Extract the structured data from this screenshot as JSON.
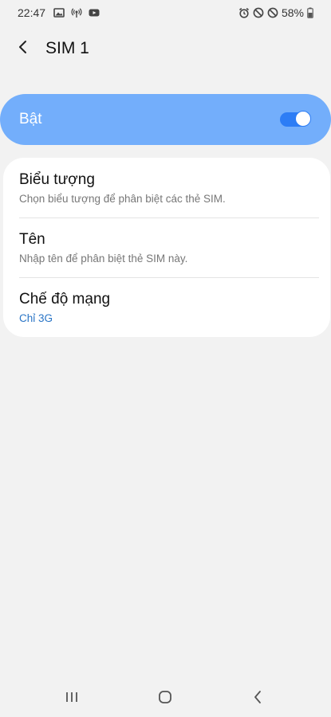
{
  "status_bar": {
    "time": "22:47",
    "battery_percent": "58%",
    "left_icons": [
      "gallery-icon",
      "wireless-broadcast-icon",
      "youtube-icon"
    ],
    "right_icons": [
      "alarm-icon",
      "do-not-disturb-icon",
      "blocked-icon",
      "battery-icon"
    ]
  },
  "header": {
    "title": "SIM 1",
    "back_icon": "chevron-left-icon"
  },
  "master_switch": {
    "label": "Bật",
    "state": "on",
    "accent_color": "#73aefb",
    "switch_color": "#2d7df5"
  },
  "settings": {
    "items": [
      {
        "title": "Biểu tượng",
        "subtitle": "Chọn biểu tượng để phân biệt các thẻ SIM."
      },
      {
        "title": "Tên",
        "subtitle": "Nhập tên để phân biệt thẻ SIM này."
      },
      {
        "title": "Chế độ mạng",
        "subtitle": "Chỉ 3G",
        "subtitle_color": "#2a75c6"
      }
    ]
  },
  "nav_bar": {
    "buttons": [
      "recent-apps-icon",
      "home-icon",
      "back-icon"
    ]
  }
}
